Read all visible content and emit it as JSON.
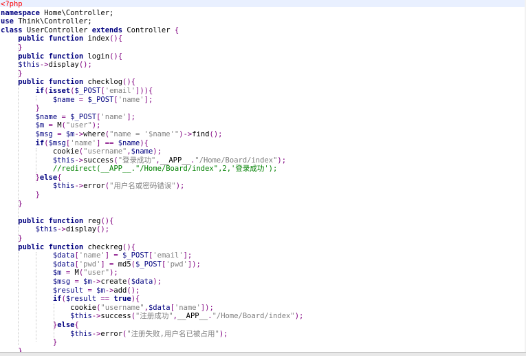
{
  "editor": {
    "lines": [
      [
        [
          "<?php",
          "#ff0000"
        ]
      ],
      [
        [
          "namespace",
          "#00007f",
          true
        ],
        [
          " Home\\Controller;",
          "#000000"
        ]
      ],
      [
        [
          "use",
          "#00007f",
          true
        ],
        [
          " Think\\Controller;",
          "#000000"
        ]
      ],
      [
        [
          "class",
          "#00007f",
          true
        ],
        [
          " UserController ",
          "#000000"
        ],
        [
          "extends",
          "#00007f",
          true
        ],
        [
          " Controller ",
          "#000000"
        ],
        [
          "{",
          "#800080"
        ]
      ],
      [
        [
          "    ",
          "#000000"
        ],
        [
          "public",
          "#00007f",
          true
        ],
        [
          " ",
          "#000000"
        ],
        [
          "function",
          "#00007f",
          true
        ],
        [
          " index",
          "#000000"
        ],
        [
          "(){",
          "#800080"
        ]
      ],
      [
        [
          "    ",
          "#000000"
        ],
        [
          "}",
          "#800080"
        ]
      ],
      [
        [
          "    ",
          "#000000"
        ],
        [
          "public",
          "#00007f",
          true
        ],
        [
          " ",
          "#000000"
        ],
        [
          "function",
          "#00007f",
          true
        ],
        [
          " login",
          "#000000"
        ],
        [
          "(){",
          "#800080"
        ]
      ],
      [
        [
          "    ",
          "#000000"
        ],
        [
          "$this",
          "#000080"
        ],
        [
          "->",
          "#800080"
        ],
        [
          "display",
          "#000000"
        ],
        [
          "();",
          "#800080"
        ]
      ],
      [
        [
          "    ",
          "#000000"
        ],
        [
          "}",
          "#800080"
        ]
      ],
      [
        [
          "    ",
          "#000000"
        ],
        [
          "public",
          "#00007f",
          true
        ],
        [
          " ",
          "#000000"
        ],
        [
          "function",
          "#00007f",
          true
        ],
        [
          " checklog",
          "#000000"
        ],
        [
          "(){",
          "#800080"
        ]
      ],
      [
        [
          "        ",
          "#000000"
        ],
        [
          "if",
          "#00007f",
          true
        ],
        [
          "(",
          "#800080"
        ],
        [
          "isset",
          "#00007f",
          true
        ],
        [
          "(",
          "#800080"
        ],
        [
          "$_POST",
          "#000080"
        ],
        [
          "[",
          "#800080"
        ],
        [
          "'email'",
          "#808080"
        ],
        [
          "])){",
          "#800080"
        ]
      ],
      [
        [
          "            ",
          "#000000"
        ],
        [
          "$name",
          "#000080"
        ],
        [
          " = ",
          "#800080"
        ],
        [
          "$_POST",
          "#000080"
        ],
        [
          "[",
          "#800080"
        ],
        [
          "'name'",
          "#808080"
        ],
        [
          "];",
          "#800080"
        ]
      ],
      [
        [
          "        ",
          "#000000"
        ],
        [
          "}",
          "#800080"
        ]
      ],
      [
        [
          "        ",
          "#000000"
        ],
        [
          "$name",
          "#000080"
        ],
        [
          " = ",
          "#800080"
        ],
        [
          "$_POST",
          "#000080"
        ],
        [
          "[",
          "#800080"
        ],
        [
          "'name'",
          "#808080"
        ],
        [
          "];",
          "#800080"
        ]
      ],
      [
        [
          "        ",
          "#000000"
        ],
        [
          "$m",
          "#000080"
        ],
        [
          " = ",
          "#800080"
        ],
        [
          "M",
          "#000000"
        ],
        [
          "(",
          "#800080"
        ],
        [
          "\"user\"",
          "#808080"
        ],
        [
          ");",
          "#800080"
        ]
      ],
      [
        [
          "        ",
          "#000000"
        ],
        [
          "$msg",
          "#000080"
        ],
        [
          " = ",
          "#800080"
        ],
        [
          "$m",
          "#000080"
        ],
        [
          "->",
          "#800080"
        ],
        [
          "where",
          "#000000"
        ],
        [
          "(",
          "#800080"
        ],
        [
          "\"name = '",
          "#808080"
        ],
        [
          "$name",
          "#808080"
        ],
        [
          "'\"",
          "#808080"
        ],
        [
          ")->",
          "#800080"
        ],
        [
          "find",
          "#000000"
        ],
        [
          "();",
          "#800080"
        ]
      ],
      [
        [
          "        ",
          "#000000"
        ],
        [
          "if",
          "#00007f",
          true
        ],
        [
          "(",
          "#800080"
        ],
        [
          "$msg",
          "#000080"
        ],
        [
          "[",
          "#800080"
        ],
        [
          "'name'",
          "#808080"
        ],
        [
          "] == ",
          "#800080"
        ],
        [
          "$name",
          "#000080"
        ],
        [
          "){",
          "#800080"
        ]
      ],
      [
        [
          "            ",
          "#000000"
        ],
        [
          "cookie",
          "#000000"
        ],
        [
          "(",
          "#800080"
        ],
        [
          "\"username\"",
          "#808080"
        ],
        [
          ",",
          "#800080"
        ],
        [
          "$name",
          "#000080"
        ],
        [
          ");",
          "#800080"
        ]
      ],
      [
        [
          "            ",
          "#000000"
        ],
        [
          "$this",
          "#000080"
        ],
        [
          "->",
          "#800080"
        ],
        [
          "success",
          "#000000"
        ],
        [
          "(",
          "#800080"
        ],
        [
          "\"登录成功\"",
          "#808080"
        ],
        [
          ",",
          "#800080"
        ],
        [
          "__APP__",
          "#000000"
        ],
        [
          ".",
          "#800080"
        ],
        [
          "\"/Home/Board/index\"",
          "#808080"
        ],
        [
          ");",
          "#800080"
        ]
      ],
      [
        [
          "            ",
          "#000000"
        ],
        [
          "//redirect(__APP__.\"/Home/Board/index\",2,'登录成功');",
          "#008000"
        ]
      ],
      [
        [
          "        ",
          "#000000"
        ],
        [
          "}",
          "#800080"
        ],
        [
          "else",
          "#00007f",
          true
        ],
        [
          "{",
          "#800080"
        ]
      ],
      [
        [
          "            ",
          "#000000"
        ],
        [
          "$this",
          "#000080"
        ],
        [
          "->",
          "#800080"
        ],
        [
          "error",
          "#000000"
        ],
        [
          "(",
          "#800080"
        ],
        [
          "\"用户名或密码错误\"",
          "#808080"
        ],
        [
          ");",
          "#800080"
        ]
      ],
      [
        [
          "        ",
          "#000000"
        ],
        [
          "}",
          "#800080"
        ]
      ],
      [
        [
          "    ",
          "#000000"
        ],
        [
          "}",
          "#800080"
        ]
      ],
      [
        [
          "",
          "#000000"
        ]
      ],
      [
        [
          "    ",
          "#000000"
        ],
        [
          "public",
          "#00007f",
          true
        ],
        [
          " ",
          "#000000"
        ],
        [
          "function",
          "#00007f",
          true
        ],
        [
          " reg",
          "#000000"
        ],
        [
          "(){",
          "#800080"
        ]
      ],
      [
        [
          "        ",
          "#000000"
        ],
        [
          "$this",
          "#000080"
        ],
        [
          "->",
          "#800080"
        ],
        [
          "display",
          "#000000"
        ],
        [
          "();",
          "#800080"
        ]
      ],
      [
        [
          "    ",
          "#000000"
        ],
        [
          "}",
          "#800080"
        ]
      ],
      [
        [
          "    ",
          "#000000"
        ],
        [
          "public",
          "#00007f",
          true
        ],
        [
          " ",
          "#000000"
        ],
        [
          "function",
          "#00007f",
          true
        ],
        [
          " checkreg",
          "#000000"
        ],
        [
          "(){",
          "#800080"
        ]
      ],
      [
        [
          "            ",
          "#000000"
        ],
        [
          "$data",
          "#000080"
        ],
        [
          "[",
          "#800080"
        ],
        [
          "'name'",
          "#808080"
        ],
        [
          "] = ",
          "#800080"
        ],
        [
          "$_POST",
          "#000080"
        ],
        [
          "[",
          "#800080"
        ],
        [
          "'email'",
          "#808080"
        ],
        [
          "];",
          "#800080"
        ]
      ],
      [
        [
          "            ",
          "#000000"
        ],
        [
          "$data",
          "#000080"
        ],
        [
          "[",
          "#800080"
        ],
        [
          "'pwd'",
          "#808080"
        ],
        [
          "] = ",
          "#800080"
        ],
        [
          "md5",
          "#000000"
        ],
        [
          "(",
          "#800080"
        ],
        [
          "$_POST",
          "#000080"
        ],
        [
          "[",
          "#800080"
        ],
        [
          "'pwd'",
          "#808080"
        ],
        [
          "]);",
          "#800080"
        ]
      ],
      [
        [
          "            ",
          "#000000"
        ],
        [
          "$m",
          "#000080"
        ],
        [
          " = ",
          "#800080"
        ],
        [
          "M",
          "#000000"
        ],
        [
          "(",
          "#800080"
        ],
        [
          "\"user\"",
          "#808080"
        ],
        [
          ");",
          "#800080"
        ]
      ],
      [
        [
          "            ",
          "#000000"
        ],
        [
          "$msg",
          "#000080"
        ],
        [
          " = ",
          "#800080"
        ],
        [
          "$m",
          "#000080"
        ],
        [
          "->",
          "#800080"
        ],
        [
          "create",
          "#000000"
        ],
        [
          "(",
          "#800080"
        ],
        [
          "$data",
          "#000080"
        ],
        [
          ");",
          "#800080"
        ]
      ],
      [
        [
          "            ",
          "#000000"
        ],
        [
          "$result",
          "#000080"
        ],
        [
          " = ",
          "#800080"
        ],
        [
          "$m",
          "#000080"
        ],
        [
          "->",
          "#800080"
        ],
        [
          "add",
          "#000000"
        ],
        [
          "();",
          "#800080"
        ]
      ],
      [
        [
          "            ",
          "#000000"
        ],
        [
          "if",
          "#00007f",
          true
        ],
        [
          "(",
          "#800080"
        ],
        [
          "$result",
          "#000080"
        ],
        [
          " == ",
          "#800080"
        ],
        [
          "true",
          "#00007f",
          true
        ],
        [
          "){",
          "#800080"
        ]
      ],
      [
        [
          "                ",
          "#000000"
        ],
        [
          "cookie",
          "#000000"
        ],
        [
          "(",
          "#800080"
        ],
        [
          "\"username\"",
          "#808080"
        ],
        [
          ",",
          "#800080"
        ],
        [
          "$data",
          "#000080"
        ],
        [
          "[",
          "#800080"
        ],
        [
          "'name'",
          "#808080"
        ],
        [
          "]);",
          "#800080"
        ]
      ],
      [
        [
          "                ",
          "#000000"
        ],
        [
          "$this",
          "#000080"
        ],
        [
          "->",
          "#800080"
        ],
        [
          "success",
          "#000000"
        ],
        [
          "(",
          "#800080"
        ],
        [
          "\"注册成功\"",
          "#808080"
        ],
        [
          ",",
          "#800080"
        ],
        [
          "__APP__",
          "#000000"
        ],
        [
          ".",
          "#800080"
        ],
        [
          "\"/Home/Board/index\"",
          "#808080"
        ],
        [
          ");",
          "#800080"
        ]
      ],
      [
        [
          "            ",
          "#000000"
        ],
        [
          "}",
          "#800080"
        ],
        [
          "else",
          "#00007f",
          true
        ],
        [
          "{",
          "#800080"
        ]
      ],
      [
        [
          "                ",
          "#000000"
        ],
        [
          "$this",
          "#000080"
        ],
        [
          "->",
          "#800080"
        ],
        [
          "error",
          "#000000"
        ],
        [
          "(",
          "#800080"
        ],
        [
          "\"注册失败,用户名已被占用\"",
          "#808080"
        ],
        [
          ");",
          "#800080"
        ]
      ],
      [
        [
          "            ",
          "#000000"
        ],
        [
          "}",
          "#800080"
        ]
      ],
      [
        [
          "    ",
          "#000000"
        ],
        [
          "}",
          "#800080"
        ]
      ]
    ]
  }
}
